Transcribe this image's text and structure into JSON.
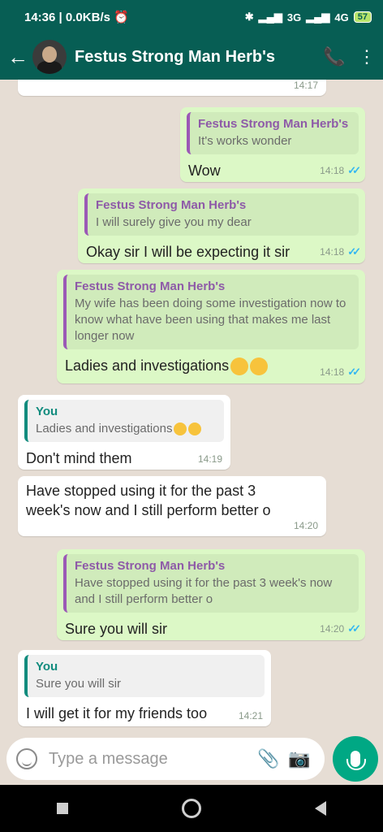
{
  "status": {
    "time": "14:36",
    "speed": "0.0KB/s",
    "network1": "3G",
    "network2": "4G",
    "battery": "57"
  },
  "header": {
    "contact_name": "Festus Strong Man Herb's"
  },
  "messages": [
    {
      "time": "14:17"
    },
    {
      "quote_name": "Festus Strong Man Herb's",
      "quote_text": "It's works wonder",
      "text": "Wow",
      "time": "14:18"
    },
    {
      "quote_name": "Festus Strong Man Herb's",
      "quote_text": "I will surely give you my dear",
      "text": "Okay sir I will be expecting it sir",
      "time": "14:18"
    },
    {
      "quote_name": "Festus Strong Man Herb's",
      "quote_text": "My wife has been doing some investigation now to know what have been using that makes me last longer now",
      "text": "Ladies and investigations",
      "time": "14:18"
    },
    {
      "quote_name": "You",
      "quote_text": "Ladies and investigations",
      "text": "Don't mind them",
      "time": "14:19"
    },
    {
      "text": "Have stopped using it for the past 3 week's now and I still perform better o",
      "time": "14:20"
    },
    {
      "quote_name": "Festus Strong Man Herb's",
      "quote_text": "Have stopped using it for the past 3 week's now and I still perform better o",
      "text": "Sure you will sir",
      "time": "14:20"
    },
    {
      "quote_name": "You",
      "quote_text": "Sure you will sir",
      "text": "I will get it for my friends too",
      "time": "14:21"
    }
  ],
  "input": {
    "placeholder": "Type a message"
  }
}
